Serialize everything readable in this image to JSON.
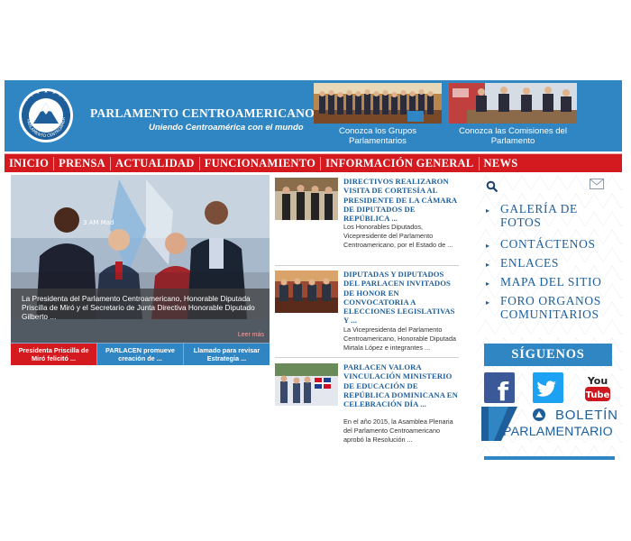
{
  "header": {
    "title": "PARLAMENTO CENTROAMERICANO",
    "slogan": "Uniendo Centroamérica con el mundo",
    "logo_ring_text": "PARLAMENTO CENTROAMERICANO",
    "promos": [
      {
        "caption": "Conozca los Grupos Parlamentarios"
      },
      {
        "caption": "Conozca las Comisiones del Parlamento"
      }
    ]
  },
  "nav": {
    "items": [
      "INICIO",
      "PRENSA",
      "ACTUALIDAD",
      "FUNCIONAMIENTO",
      "INFORMACIÓN GENERAL",
      "NEWS"
    ]
  },
  "slider": {
    "caption": "La Presidenta del Parlamento Centroamericano, Honorable Diputada Priscilla de Miró y el Secretario de Junta Directiva Honorable Diputado Gilberto ...",
    "read_more": "Leer más",
    "tabs": [
      {
        "label": "Presidenta Priscilla de Miró felicitó ..."
      },
      {
        "label": "PARLACEN promueve creación de ..."
      },
      {
        "label": "Llamado para revisar Estrategia ..."
      }
    ],
    "photo_text": "3 AM Mad"
  },
  "news": {
    "items": [
      {
        "title": "DIRECTIVOS REALIZARON VISITA DE CORTESÍA AL PRESIDENTE DE LA CÁMARA DE DIPUTADOS DE REPÚBLICA ...",
        "summary": "Los Honorables Diputados, Vicepresidente del Parlamento Centroamericano, por el Estado de ..."
      },
      {
        "title": "DIPUTADAS Y DIPUTADOS DEL PARLACEN INVITADOS DE HONOR EN CONVOCATORIA A ELECCIONES LEGISLATIVAS Y ...",
        "summary": "La Vicepresidenta del Parlamento Centroamericano, Honorable Diputada Mirtala López e integrantes ..."
      },
      {
        "title": "PARLACEN VALORA VINCULACIÓN MINISTERIO DE EDUCACIÓN DE REPÚBLICA DOMINICANA EN CELEBRACIÓN DÍA ...",
        "summary": "En el año 2015, la Asamblea Plenaria del Parlamento Centroamericano aprobó la Resolución ..."
      }
    ]
  },
  "sidebar": {
    "links": [
      {
        "label": "GALERÍA DE FOTOS"
      },
      {
        "label": "CONTÁCTENOS"
      },
      {
        "label": "ENLACES"
      },
      {
        "label": "MAPA DEL SITIO"
      },
      {
        "label": "FORO ORGANOS COMUNITARIOS"
      }
    ],
    "follow_label": "SÍGUENOS",
    "social": {
      "facebook": "f",
      "youtube_you": "You",
      "youtube_tube": "Tube"
    },
    "boletin_line1": "BOLETÍN",
    "boletin_line2": "PARLAMENTARIO"
  },
  "colors": {
    "brand_blue": "#2f86c3",
    "nav_red": "#d4191f",
    "link_blue": "#1d5e9b",
    "facebook": "#3b5998",
    "twitter": "#1da1f2",
    "youtube": "#cc181e"
  },
  "icons": [
    "search-icon",
    "mail-icon",
    "facebook-icon",
    "twitter-icon",
    "youtube-icon",
    "bullet-icon"
  ]
}
